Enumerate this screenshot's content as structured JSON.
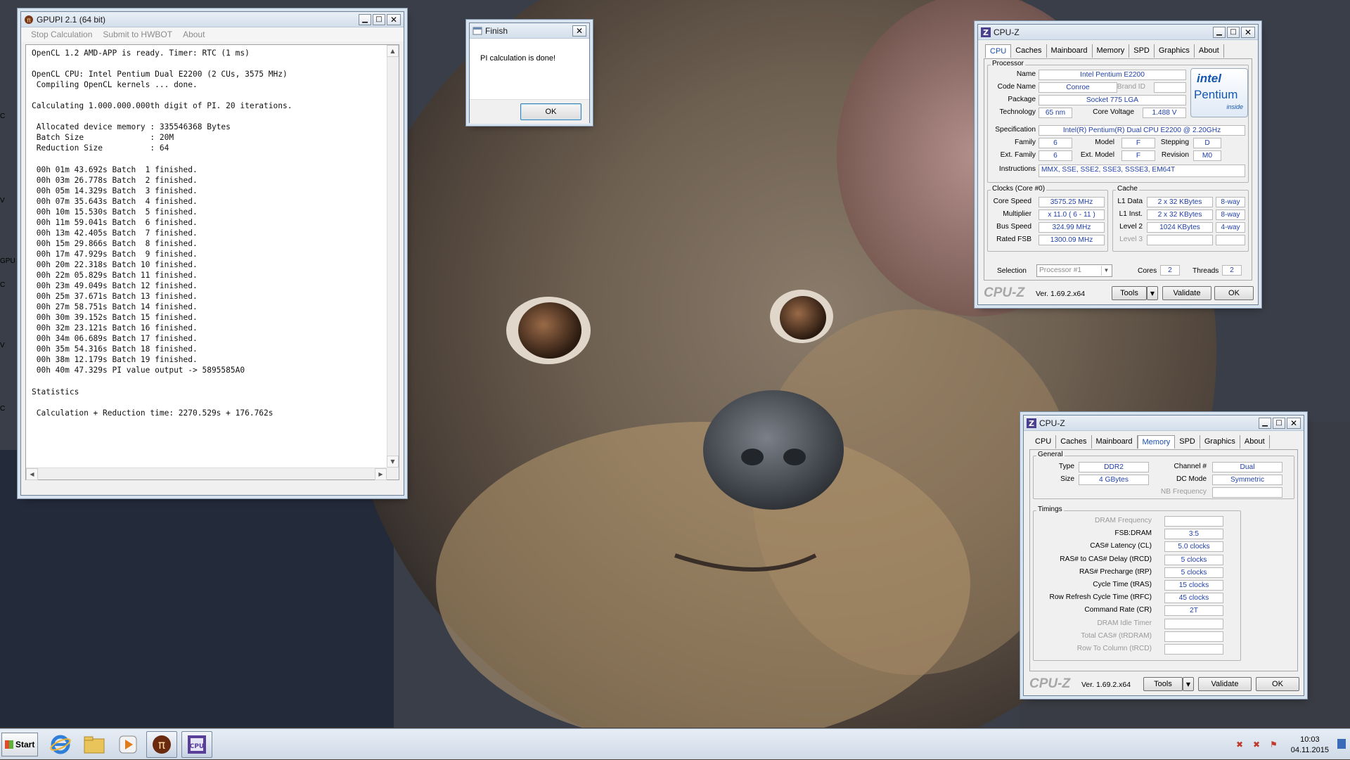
{
  "desktop": {
    "side_glyphs": [
      "C",
      "V",
      "GPU",
      "C",
      "V",
      "C"
    ]
  },
  "gpupi": {
    "title": "GPUPI 2.1 (64 bit)",
    "menu": [
      "Stop Calculation",
      "Submit to HWBOT",
      "About"
    ],
    "console_lines": [
      "OpenCL 1.2 AMD-APP is ready. Timer: RTC (1 ms)",
      "",
      "OpenCL CPU: Intel Pentium Dual E2200 (2 CUs, 3575 MHz)",
      " Compiling OpenCL kernels ... done.",
      "",
      "Calculating 1.000.000.000th digit of PI. 20 iterations.",
      "",
      " Allocated device memory : 335546368 Bytes",
      " Batch Size              : 20M",
      " Reduction Size          : 64",
      "",
      " 00h 01m 43.692s Batch  1 finished.",
      " 00h 03m 26.778s Batch  2 finished.",
      " 00h 05m 14.329s Batch  3 finished.",
      " 00h 07m 35.643s Batch  4 finished.",
      " 00h 10m 15.530s Batch  5 finished.",
      " 00h 11m 59.041s Batch  6 finished.",
      " 00h 13m 42.405s Batch  7 finished.",
      " 00h 15m 29.866s Batch  8 finished.",
      " 00h 17m 47.929s Batch  9 finished.",
      " 00h 20m 22.318s Batch 10 finished.",
      " 00h 22m 05.829s Batch 11 finished.",
      " 00h 23m 49.049s Batch 12 finished.",
      " 00h 25m 37.671s Batch 13 finished.",
      " 00h 27m 58.751s Batch 14 finished.",
      " 00h 30m 39.152s Batch 15 finished.",
      " 00h 32m 23.121s Batch 16 finished.",
      " 00h 34m 06.689s Batch 17 finished.",
      " 00h 35m 54.316s Batch 18 finished.",
      " 00h 38m 12.179s Batch 19 finished.",
      " 00h 40m 47.329s PI value output -> 5895585A0",
      "",
      "Statistics",
      "",
      " Calculation + Reduction time: 2270.529s + 176.762s"
    ]
  },
  "finish_dialog": {
    "title": "Finish",
    "message": "PI calculation is done!",
    "ok": "OK"
  },
  "cpuz_cpu": {
    "title": "CPU-Z",
    "tabs": [
      "CPU",
      "Caches",
      "Mainboard",
      "Memory",
      "SPD",
      "Graphics",
      "About"
    ],
    "active_tab": "CPU",
    "processor": {
      "legend": "Processor",
      "name_label": "Name",
      "name": "Intel Pentium E2200",
      "codename_label": "Code Name",
      "codename": "Conroe",
      "brandid_label": "Brand ID",
      "brandid": "",
      "package_label": "Package",
      "package": "Socket 775 LGA",
      "technology_label": "Technology",
      "technology": "65 nm",
      "corevoltage_label": "Core Voltage",
      "corevoltage": "1.488 V",
      "spec_label": "Specification",
      "spec": "Intel(R) Pentium(R) Dual  CPU  E2200  @ 2.20GHz",
      "family_label": "Family",
      "family": "6",
      "model_label": "Model",
      "model": "F",
      "stepping_label": "Stepping",
      "stepping": "D",
      "extfamily_label": "Ext. Family",
      "extfamily": "6",
      "extmodel_label": "Ext. Model",
      "extmodel": "F",
      "revision_label": "Revision",
      "revision": "M0",
      "instructions_label": "Instructions",
      "instructions": "MMX, SSE, SSE2, SSE3, SSSE3, EM64T",
      "logo_line1": "intel",
      "logo_line2": "Pentium",
      "logo_line3": "inside"
    },
    "clocks": {
      "legend": "Clocks (Core #0)",
      "corespeed_label": "Core Speed",
      "corespeed": "3575.25 MHz",
      "multiplier_label": "Multiplier",
      "multiplier": "x 11.0 ( 6 - 11 )",
      "busspeed_label": "Bus Speed",
      "busspeed": "324.99 MHz",
      "ratedfsb_label": "Rated FSB",
      "ratedfsb": "1300.09 MHz"
    },
    "cache": {
      "legend": "Cache",
      "l1data_label": "L1 Data",
      "l1data": "2 x 32 KBytes",
      "l1data_way": "8-way",
      "l1inst_label": "L1 Inst.",
      "l1inst": "2 x 32 KBytes",
      "l1inst_way": "8-way",
      "level2_label": "Level 2",
      "level2": "1024 KBytes",
      "level2_way": "4-way",
      "level3_label": "Level 3",
      "level3": "",
      "level3_way": ""
    },
    "selection_label": "Selection",
    "selection": "Processor #1",
    "cores_label": "Cores",
    "cores": "2",
    "threads_label": "Threads",
    "threads": "2",
    "brand": "CPU-Z",
    "version": "Ver. 1.69.2.x64",
    "tools": "Tools",
    "validate": "Validate",
    "ok": "OK"
  },
  "cpuz_mem": {
    "title": "CPU-Z",
    "tabs": [
      "CPU",
      "Caches",
      "Mainboard",
      "Memory",
      "SPD",
      "Graphics",
      "About"
    ],
    "active_tab": "Memory",
    "general": {
      "legend": "General",
      "type_label": "Type",
      "type": "DDR2",
      "size_label": "Size",
      "size": "4 GBytes",
      "channel_label": "Channel #",
      "channel": "Dual",
      "dcmode_label": "DC Mode",
      "dcmode": "Symmetric",
      "nbfreq_label": "NB Frequency",
      "nbfreq": ""
    },
    "timings": {
      "legend": "Timings",
      "rows": [
        {
          "label": "DRAM Frequency",
          "value": "",
          "dim": true
        },
        {
          "label": "FSB:DRAM",
          "value": "3:5",
          "dim": false
        },
        {
          "label": "CAS# Latency (CL)",
          "value": "5.0 clocks",
          "dim": false
        },
        {
          "label": "RAS# to CAS# Delay (tRCD)",
          "value": "5 clocks",
          "dim": false
        },
        {
          "label": "RAS# Precharge (tRP)",
          "value": "5 clocks",
          "dim": false
        },
        {
          "label": "Cycle Time (tRAS)",
          "value": "15 clocks",
          "dim": false
        },
        {
          "label": "Row Refresh Cycle Time (tRFC)",
          "value": "45 clocks",
          "dim": false
        },
        {
          "label": "Command Rate (CR)",
          "value": "2T",
          "dim": false
        },
        {
          "label": "DRAM Idle Timer",
          "value": "",
          "dim": true
        },
        {
          "label": "Total CAS# (tRDRAM)",
          "value": "",
          "dim": true
        },
        {
          "label": "Row To Column (tRCD)",
          "value": "",
          "dim": true
        }
      ]
    },
    "brand": "CPU-Z",
    "version": "Ver. 1.69.2.x64",
    "tools": "Tools",
    "validate": "Validate",
    "ok": "OK"
  },
  "taskbar": {
    "start_label": "Start",
    "time": "10:03",
    "date": "04.11.2015"
  },
  "colors": {
    "value_text": "#1f3fa8",
    "active_tab": "#1a4fb0"
  }
}
